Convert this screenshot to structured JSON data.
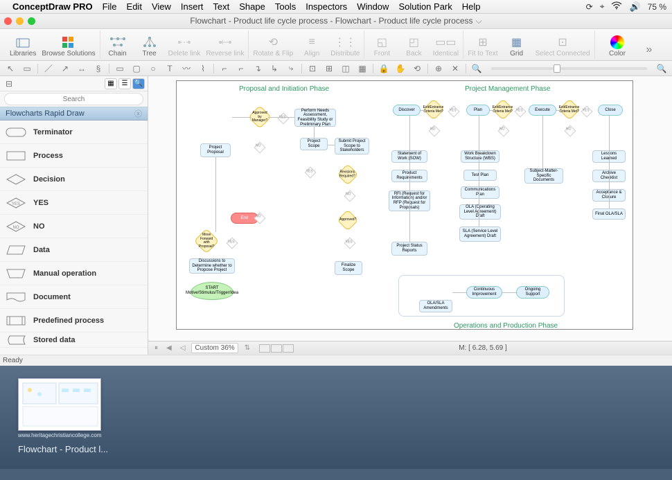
{
  "menubar": {
    "app_name": "ConceptDraw PRO",
    "items": [
      "File",
      "Edit",
      "View",
      "Insert",
      "Text",
      "Shape",
      "Tools",
      "Inspectors",
      "Window",
      "Solution Park",
      "Help"
    ],
    "battery_pct": "75 %"
  },
  "window": {
    "title": "Flowchart - Product life cycle process - Flowchart - Product life cycle process"
  },
  "toolbar": {
    "libraries": "Libraries",
    "browse_solutions": "Browse Solutions",
    "chain": "Chain",
    "tree": "Tree",
    "delete_link": "Delete link",
    "reverse_link": "Reverse link",
    "rotate_flip": "Rotate & Flip",
    "align": "Align",
    "distribute": "Distribute",
    "front": "Front",
    "back": "Back",
    "identical": "Identical",
    "fit_to_text": "Fit to Text",
    "grid": "Grid",
    "select_connected": "Select Connected",
    "color": "Color"
  },
  "sidebar": {
    "search_placeholder": "Search",
    "category": "Flowcharts Rapid Draw",
    "items": [
      {
        "label": "Terminator"
      },
      {
        "label": "Process"
      },
      {
        "label": "Decision"
      },
      {
        "label": "YES"
      },
      {
        "label": "NO"
      },
      {
        "label": "Data"
      },
      {
        "label": "Manual operation"
      },
      {
        "label": "Document"
      },
      {
        "label": "Predefined process"
      },
      {
        "label": "Stored data"
      }
    ]
  },
  "canvas": {
    "phase1": "Proposal and Initiation Phase",
    "phase2": "Project Management Phase",
    "phase3": "Operations and Production Phase",
    "nodes": {
      "approved_mgr": "Approved by Manager?",
      "perform_needs": "Perform Needs Assessment, Feasibility Study or Preliminary Plan",
      "project_proposal": "Project Proposal",
      "project_scope": "Project Scope",
      "submit_scope": "Submit Project Scope to Stakeholders",
      "revisions": "Revisions Required?",
      "end": "End",
      "approved": "Approved?",
      "move_forward": "Move Forward with Proposal?",
      "discussions": "Discussions to Determine whether to Propose Project",
      "start": "START Motive/Stimulus/Trigger/Idea",
      "finalize_scope": "Finalize Scope",
      "discover": "Discover",
      "crit1": "Exit/Entrance Criteria Met?",
      "plan": "Plan",
      "crit2": "Exit/Entrance Criteria Met?",
      "execute": "Execute",
      "crit3": "Exit/Entrance Criteria Met?",
      "close": "Close",
      "sow": "Statement of Work (SOW)",
      "prod_req": "Product Requirements",
      "rfi": "RFI (Request for Information) and/or RFP (Request for Proposals)",
      "status_reports": "Project Status Reports",
      "wbs": "Work Breakdown Structure (WBS)",
      "test_plan": "Test Plan",
      "comm_plan": "Communications Plan",
      "ola": "OLA (Operating Level Agreement) Draft",
      "sla": "SLA (Service Level Agreement) Draft",
      "subject_docs": "Subject-Matter-Specific Documents",
      "lessons": "Lessons Learned",
      "archive": "Archive Checklist",
      "acceptance": "Acceptance & Closure",
      "final_ola": "Final OLA/SLA",
      "ola_amend": "OLA/SLA Amendments",
      "continuous": "Continuous Improvement",
      "ongoing": "Ongoing Support",
      "yes": "YES",
      "no": "NO"
    }
  },
  "bottom": {
    "zoom_label": "Custom 36%",
    "coords": "M: [ 6.28, 5.69 ]"
  },
  "status": {
    "ready": "Ready"
  },
  "dock": {
    "caption": "www.heritagechristiancollege.com",
    "title": "Flowchart - Product l..."
  }
}
